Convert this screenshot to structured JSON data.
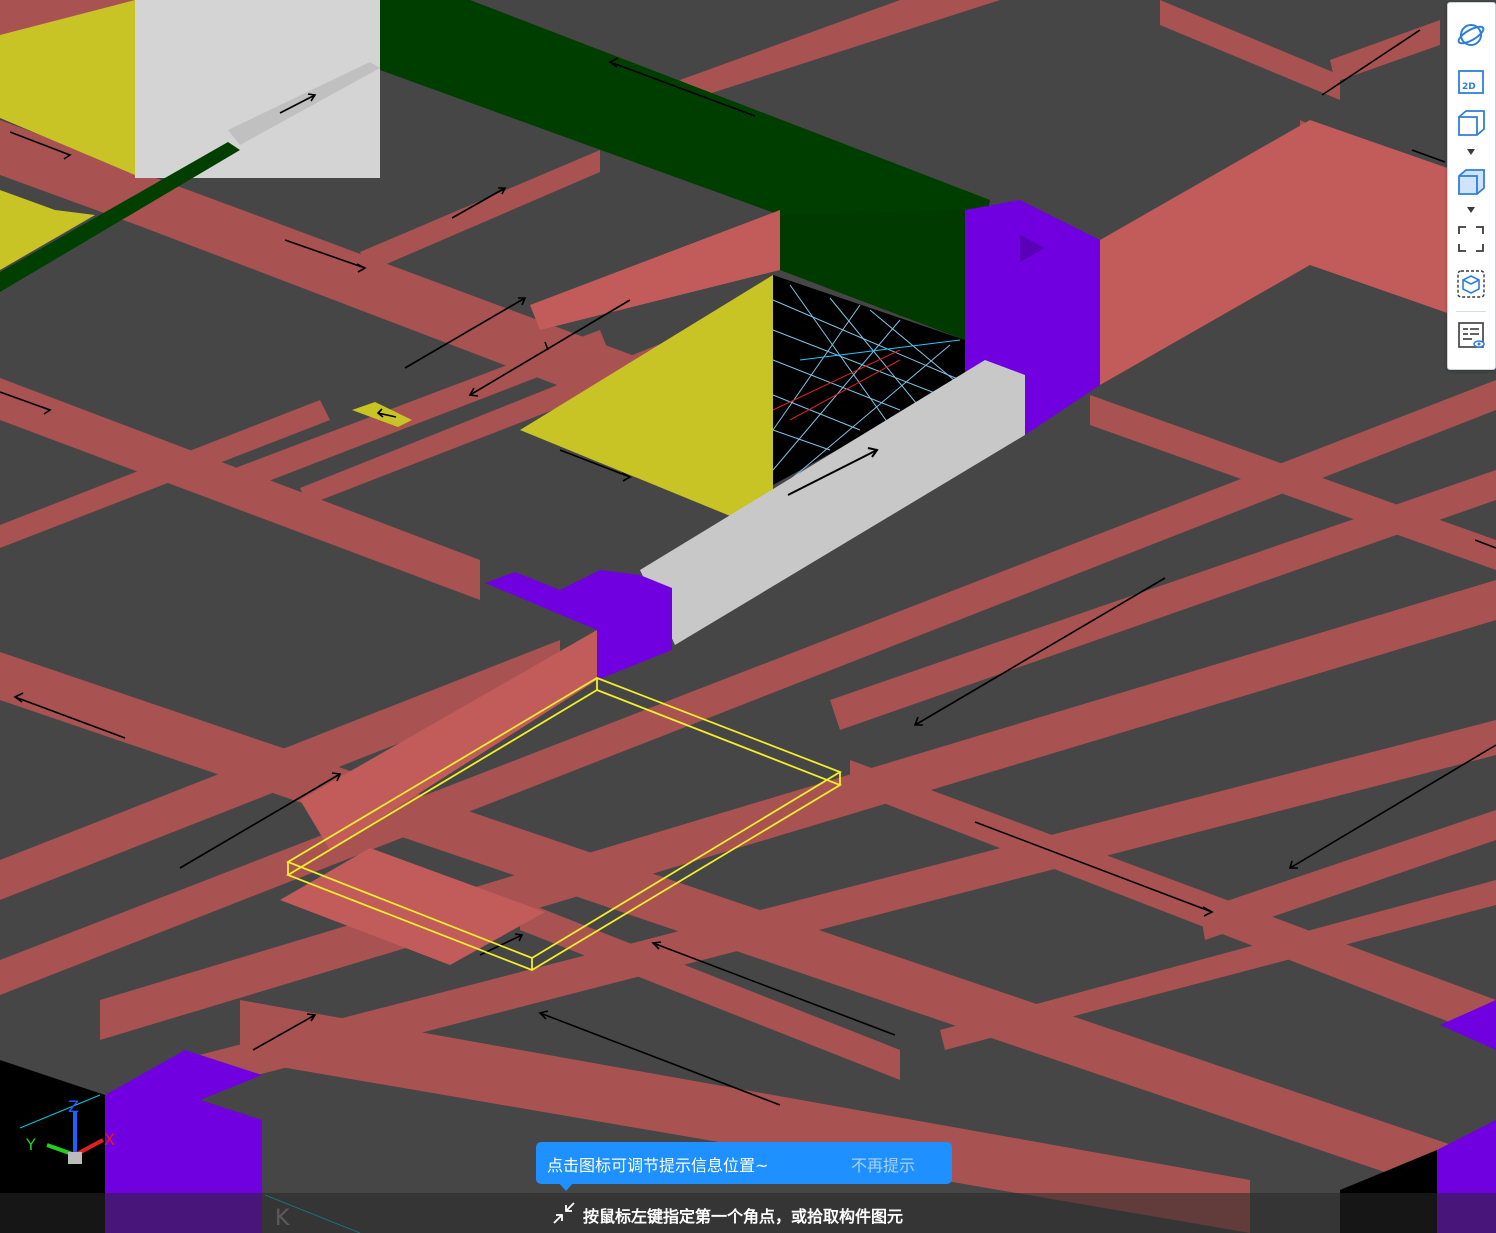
{
  "scene": {
    "colors": {
      "background": "#464646",
      "beam": "#a85252",
      "beam_side": "#c15c5a",
      "slab": "#434343",
      "wall_green": "#003e00",
      "wall_yellow": "#c8c425",
      "column_purple": "#7000e0",
      "beam_gray": "#c8c8c8",
      "selection": "#f2ee2a",
      "axis_x": "#e02020",
      "axis_y": "#20d020",
      "axis_z": "#2060ff"
    },
    "axis_labels": {
      "x": "X",
      "y": "Y",
      "z": "Z"
    },
    "grid_label": "K"
  },
  "toolbar": {
    "buttons": [
      {
        "icon": "orbit-icon",
        "label": "动态观察"
      },
      {
        "icon": "2d-view-icon",
        "text": "2D"
      },
      {
        "icon": "3d-box-icon",
        "has_dropdown": true
      },
      {
        "icon": "3d-solid-box-icon",
        "has_dropdown": true
      },
      {
        "icon": "fit-view-icon"
      },
      {
        "icon": "3d-section-icon"
      },
      {
        "icon": "display-settings-icon"
      }
    ]
  },
  "tip": {
    "message": "点击图标可调节提示信息位置~",
    "dismiss_label": "不再提示"
  },
  "status": {
    "icon": "collapse-arrows-icon",
    "prompt": "按鼠标左键指定第一个角点，或拾取构件图元"
  }
}
